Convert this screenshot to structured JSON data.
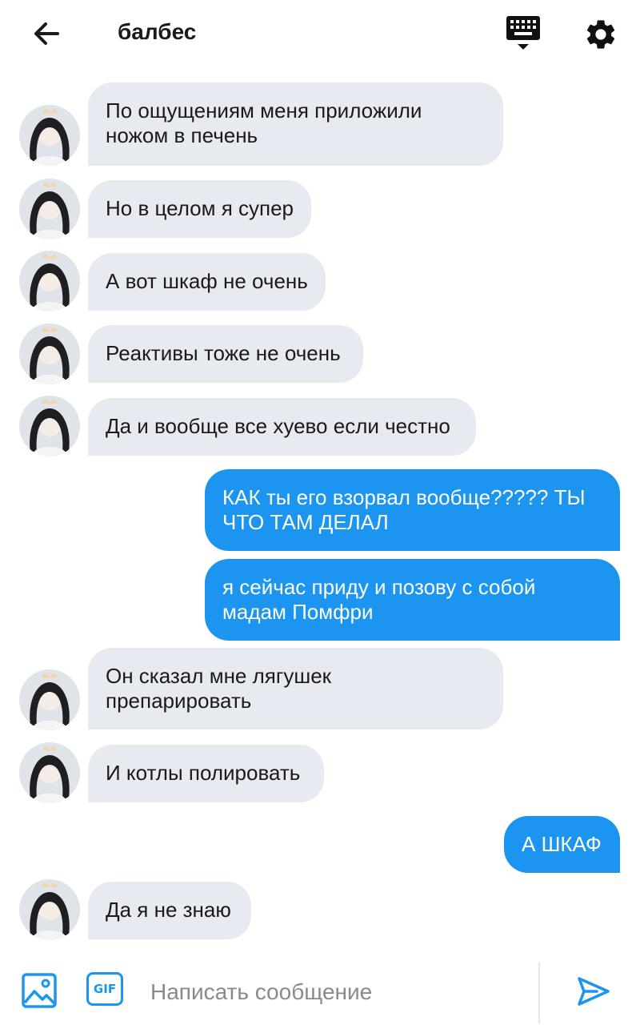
{
  "header": {
    "back_icon": "arrow-left-icon",
    "title": "балбес",
    "keyboard_icon": "keyboard-icon",
    "settings_icon": "gear-icon"
  },
  "colors": {
    "incoming_bubble": "#e8eaf1",
    "outgoing_bubble": "#1b95ef",
    "accent": "#1b95ef"
  },
  "messages": [
    {
      "direction": "in",
      "text": "По ощущениям меня приложили\nножом в печень"
    },
    {
      "direction": "in",
      "text": "Но в целом я супер"
    },
    {
      "direction": "in",
      "text": "А вот шкаф не очень"
    },
    {
      "direction": "in",
      "text": "Реактивы тоже не очень"
    },
    {
      "direction": "in",
      "text": "Да и вообще все хуево если честно"
    },
    {
      "direction": "out",
      "text": "КАК ты его взорвал вообще????? ТЫ\nЧТО ТАМ ДЕЛАЛ"
    },
    {
      "direction": "out",
      "text": "я сейчас приду и позову с собой\nмадам Помфри"
    },
    {
      "direction": "in",
      "text": "Он сказал мне лягушек\nпрепарировать"
    },
    {
      "direction": "in",
      "text": "И котлы полировать"
    },
    {
      "direction": "out",
      "text": "А ШКАФ"
    },
    {
      "direction": "in",
      "text": "Да я не знаю"
    }
  ],
  "composer": {
    "image_icon": "image-icon",
    "gif_label": "GIF",
    "placeholder": "Написать сообщение",
    "send_icon": "send-icon"
  }
}
